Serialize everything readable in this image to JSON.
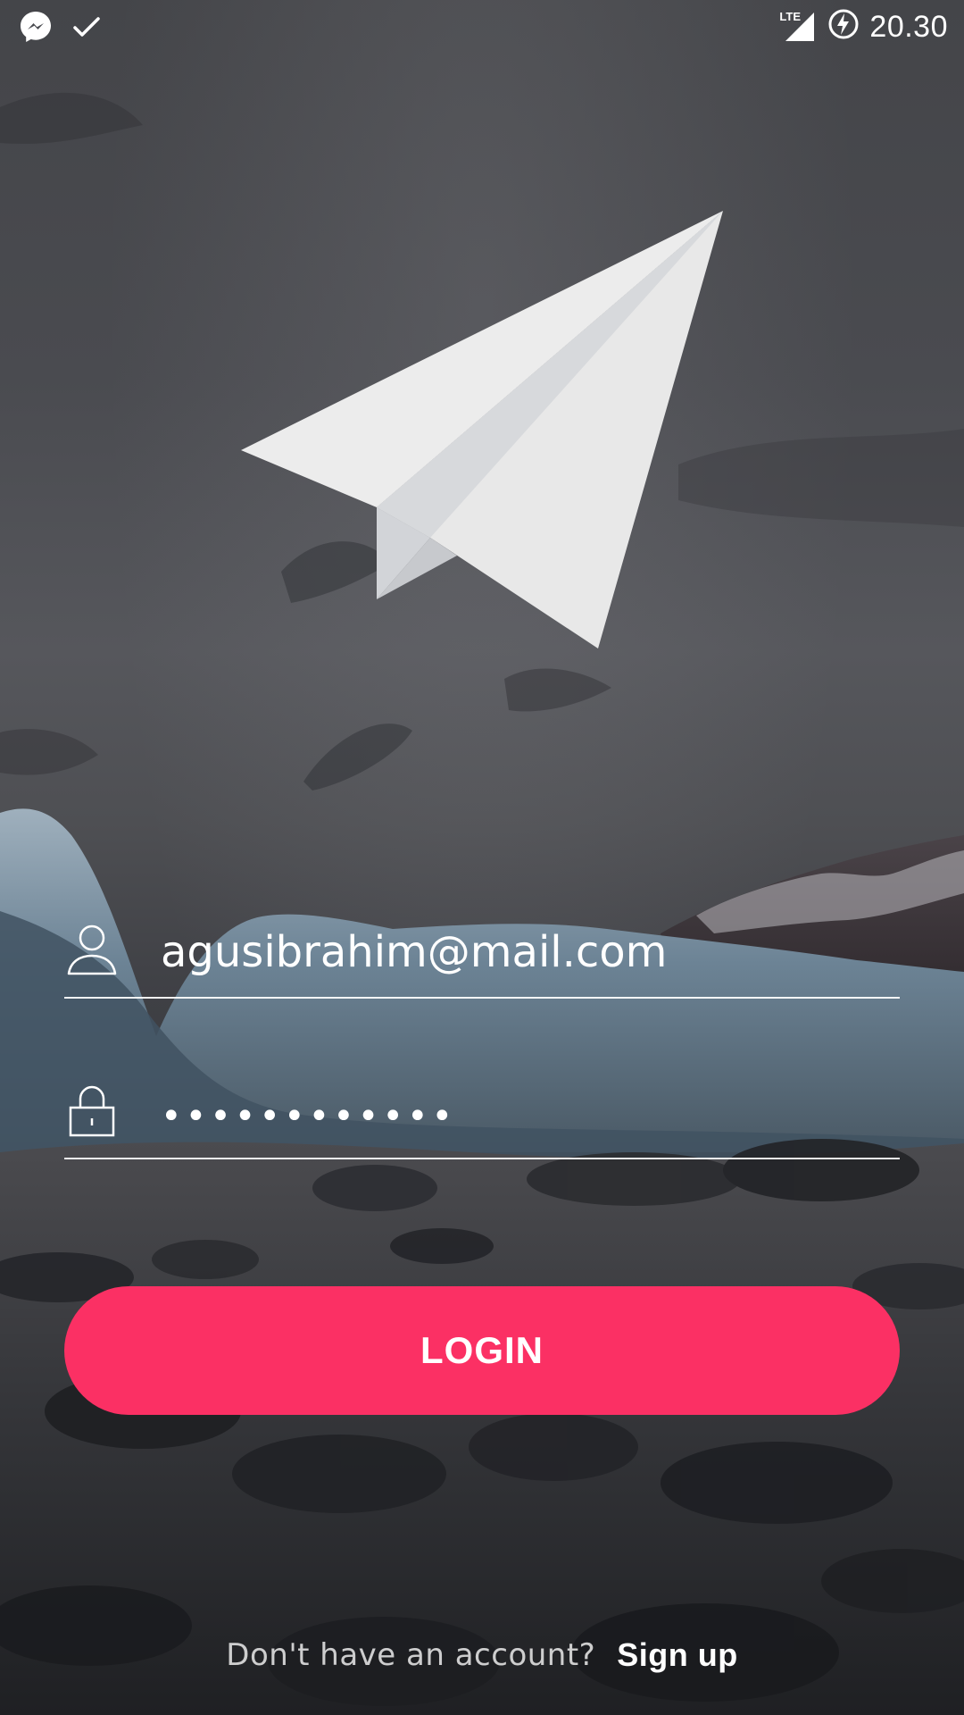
{
  "status_bar": {
    "notifications": [
      "messenger-icon",
      "check-icon"
    ],
    "network": "LTE",
    "time": "20.30",
    "icons": [
      "lte-signal-icon",
      "battery-charging-icon"
    ]
  },
  "login_form": {
    "email_value": "agusibrahim@mail.com",
    "password_value": "••••••••••••",
    "login_label": "LOGIN",
    "icons": {
      "email": "user-icon",
      "password": "lock-icon"
    }
  },
  "footer": {
    "prompt": "Don't have an account?",
    "signup_label": "Sign up"
  },
  "colors": {
    "accent": "#fb3064",
    "text": "#ffffff",
    "logo": "#ececec"
  }
}
